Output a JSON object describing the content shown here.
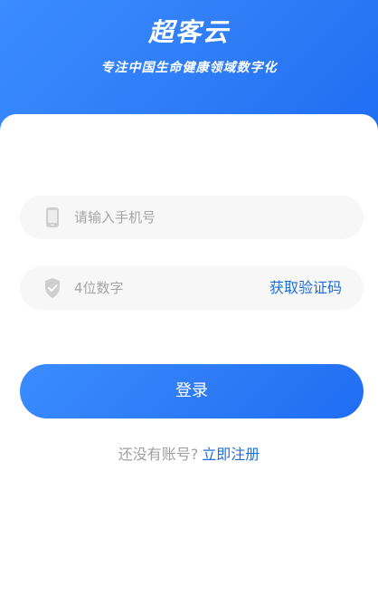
{
  "header": {
    "title": "超客云",
    "subtitle": "专注中国生命健康领域数字化"
  },
  "form": {
    "phone": {
      "icon": "phone-icon",
      "placeholder": "请输入手机号",
      "value": ""
    },
    "code": {
      "icon": "shield-check-icon",
      "placeholder": "4位数字",
      "value": "",
      "get_code_label": "获取验证码"
    },
    "login_label": "登录"
  },
  "register": {
    "prompt": "还没有账号?",
    "link_label": "立即注册"
  },
  "colors": {
    "accent": "#2f7cf6",
    "link": "#1f6ed8",
    "field_bg": "#f7f7f7"
  }
}
